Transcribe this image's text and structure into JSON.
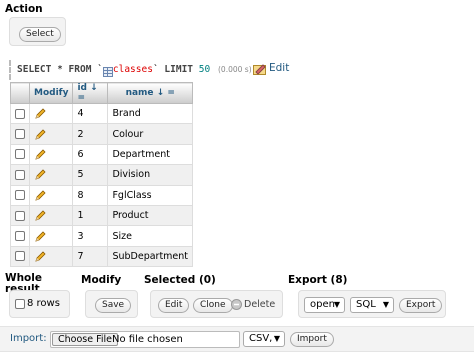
{
  "action": {
    "heading": "Action",
    "select_label": "Select"
  },
  "query": {
    "select_kw": "SELECT",
    "star": "*",
    "from_kw": "FROM",
    "table": "classes",
    "limit_kw": "LIMIT",
    "limit_value": "50",
    "timing": "(0.000 s)",
    "edit_label": "Edit"
  },
  "table": {
    "headers": {
      "modify": "Modify",
      "id": "id ↓ =",
      "name": "name ↓ ="
    },
    "rows": [
      {
        "id": "4",
        "name": "Brand"
      },
      {
        "id": "2",
        "name": "Colour"
      },
      {
        "id": "6",
        "name": "Department"
      },
      {
        "id": "5",
        "name": "Division"
      },
      {
        "id": "8",
        "name": "FglClass"
      },
      {
        "id": "1",
        "name": "Product"
      },
      {
        "id": "3",
        "name": "Size"
      },
      {
        "id": "7",
        "name": "SubDepartment"
      }
    ]
  },
  "whole_result": {
    "heading_line1": "Whole",
    "heading_line2": "result",
    "rows_label": "8 rows"
  },
  "modify": {
    "heading": "Modify",
    "save_label": "Save"
  },
  "selected": {
    "heading": "Selected (0)",
    "edit_label": "Edit",
    "clone_label": "Clone",
    "delete_label": "Delete"
  },
  "export": {
    "heading": "Export (8)",
    "mode_value": "open",
    "format_value": "SQL",
    "export_label": "Export"
  },
  "import": {
    "label": "Import:",
    "choose_file_label": "Choose File",
    "no_file_text": "No file chosen",
    "format_value": "CSV,",
    "import_label": "Import"
  },
  "colors": {
    "link": "#235a81",
    "table_name": "#dd0000",
    "number": "#008080"
  },
  "icons": {
    "pencil": "pencil-icon",
    "table": "table-icon",
    "edit": "edit-icon",
    "delete": "delete-icon"
  }
}
